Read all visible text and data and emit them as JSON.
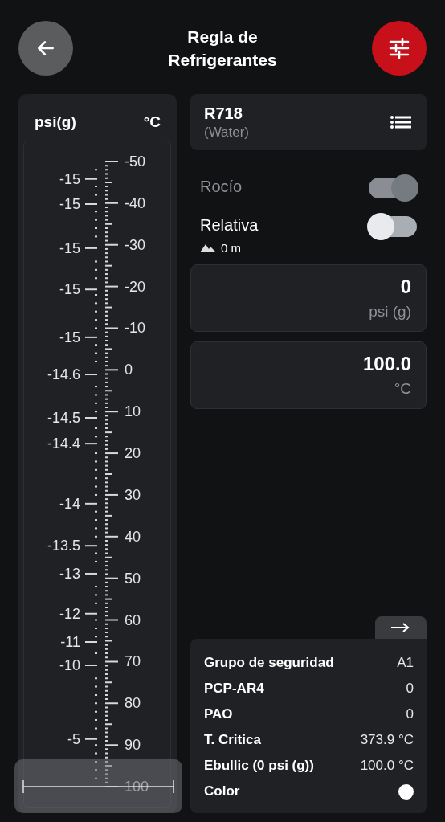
{
  "header": {
    "title_lines": [
      "Regla de",
      "Refrigerantes"
    ]
  },
  "ruler": {
    "left_unit": "psi(g)",
    "right_unit": "°C",
    "right_labels": [
      "-50",
      "-40",
      "-30",
      "-20",
      "-10",
      "0",
      "10",
      "20",
      "30",
      "40",
      "50",
      "60",
      "70",
      "80",
      "90",
      "100"
    ],
    "left_labels": [
      "-15",
      "-15",
      "-15",
      "-15",
      "-15",
      "-14.6",
      "-14.5",
      "-14.4",
      "-14",
      "-13.5",
      "-13",
      "-12",
      "-11",
      "-10",
      "-5"
    ]
  },
  "refrigerant": {
    "code": "R718",
    "name": "(Water)"
  },
  "toggles": [
    {
      "label": "Rocío",
      "on": true,
      "disabled": true
    },
    {
      "label": "Relativa",
      "on": false,
      "disabled": false,
      "altitude": "0 m"
    }
  ],
  "fields": [
    {
      "value": "0",
      "unit": "psi (g)"
    },
    {
      "value": "100.0",
      "unit": "°C"
    }
  ],
  "info": {
    "rows": [
      {
        "kind": "text",
        "label": "Grupo de seguridad",
        "value": "A1"
      },
      {
        "kind": "text",
        "label": "PCP-AR4",
        "value": "0"
      },
      {
        "kind": "text",
        "label": "PAO",
        "value": "0"
      },
      {
        "kind": "text",
        "label": "T. Critica",
        "value": "373.9 °C"
      },
      {
        "kind": "text",
        "label": "Ebullic (0 psi (g))",
        "value": "100.0 °C"
      },
      {
        "kind": "swatch",
        "label": "Color",
        "color": "#ffffff"
      }
    ]
  }
}
